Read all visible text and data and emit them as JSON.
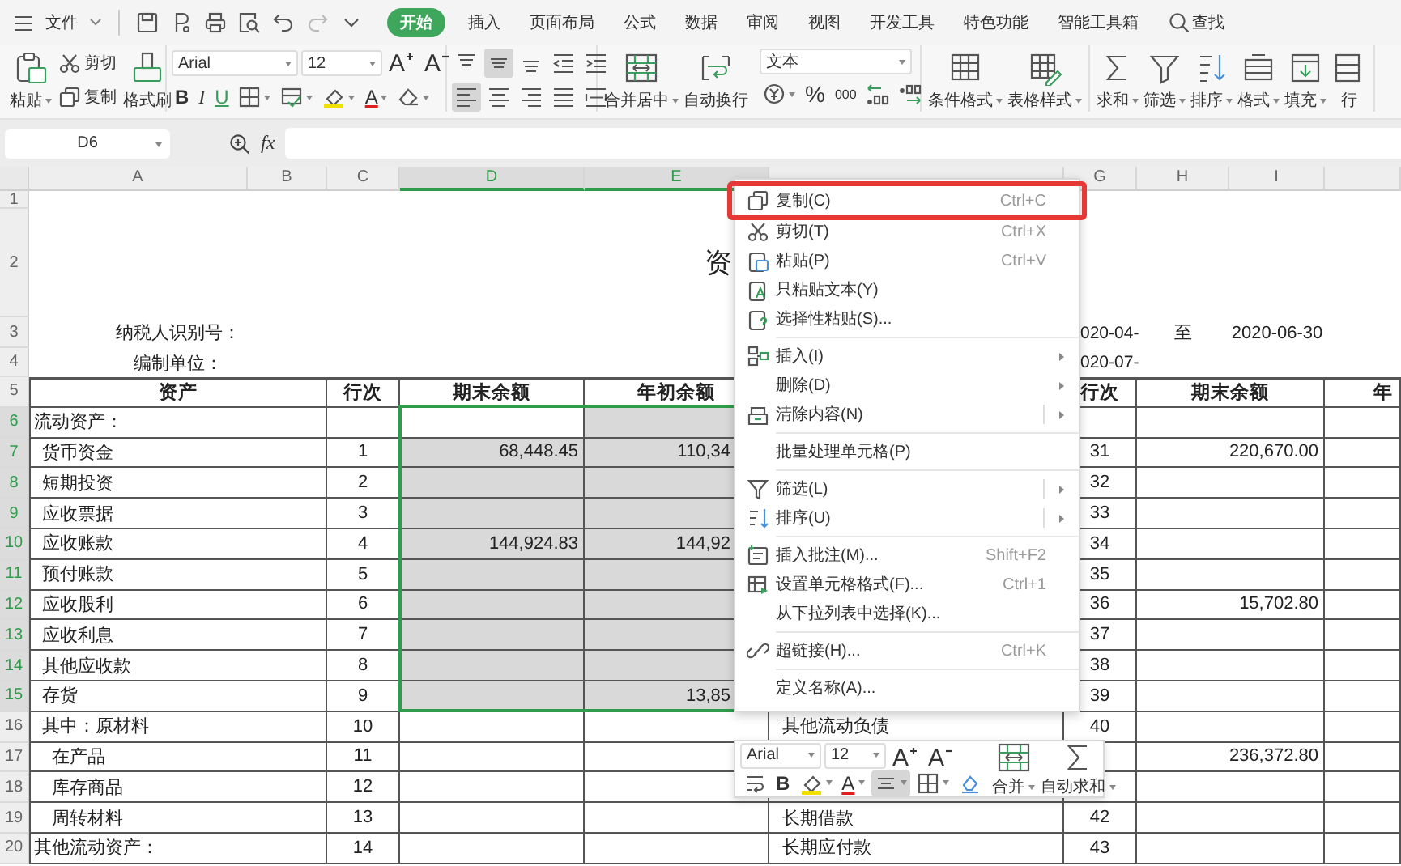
{
  "menu_bar": {
    "file_menu": "文件",
    "redo_disabled": true,
    "tabs": [
      {
        "label": "开始",
        "selected": true
      },
      {
        "label": "插入",
        "selected": false
      },
      {
        "label": "页面布局",
        "selected": false
      },
      {
        "label": "公式",
        "selected": false
      },
      {
        "label": "数据",
        "selected": false
      },
      {
        "label": "审阅",
        "selected": false
      },
      {
        "label": "视图",
        "selected": false
      },
      {
        "label": "开发工具",
        "selected": false
      },
      {
        "label": "特色功能",
        "selected": false
      },
      {
        "label": "智能工具箱",
        "selected": false
      }
    ],
    "search": "查找"
  },
  "ribbon": {
    "paste": "粘贴",
    "cut": "剪切",
    "copy": "复制",
    "format_painter": "格式刷",
    "font": "Arial",
    "font_size": "12",
    "grow_font": "A",
    "shrink_font": "A",
    "bold": "B",
    "italic": "I",
    "underline": "U",
    "font_color": "A",
    "vertical_align": [
      {
        "selected": false
      },
      {
        "selected": true
      },
      {
        "selected": false
      }
    ],
    "horizontal_align": [
      {
        "selected": true
      },
      {
        "selected": false
      },
      {
        "selected": false
      },
      {
        "selected": false
      },
      {
        "selected": false
      }
    ],
    "merge": "合并居中",
    "wrap": "自动换行",
    "number_format": "文本",
    "percent": "%",
    "thousands": "000",
    "tools": [
      {
        "label": "条件格式",
        "dropdown": true
      },
      {
        "label": "表格样式",
        "dropdown": true
      },
      {
        "label": "求和",
        "dropdown": true
      },
      {
        "label": "筛选",
        "dropdown": true
      },
      {
        "label": "排序",
        "dropdown": true
      },
      {
        "label": "格式",
        "dropdown": true
      },
      {
        "label": "填充",
        "dropdown": true
      },
      {
        "label": "行",
        "dropdown": false
      }
    ]
  },
  "formula_bar": {
    "name_box": "D6",
    "fx_label": "fx"
  },
  "sheet": {
    "columns": [
      {
        "label": "A",
        "selected": false
      },
      {
        "label": "B",
        "selected": false
      },
      {
        "label": "C",
        "selected": false
      },
      {
        "label": "D",
        "selected": true
      },
      {
        "label": "E",
        "selected": true
      },
      {
        "selected": false
      },
      {
        "label": "G",
        "selected": false
      },
      {
        "label": "H",
        "selected": false
      },
      {
        "label": "I",
        "selected": false
      }
    ],
    "rows": [
      {
        "header": "1",
        "kind": "blank",
        "selected": false,
        "active_cell": false
      },
      {
        "header": "2",
        "kind": "title",
        "selected": false,
        "active_cell": false,
        "cells": {
          "E": "资"
        }
      },
      {
        "header": "3",
        "kind": "info",
        "selected": false,
        "active_cell": false,
        "cells": {
          "A": "纳税人识别号：",
          "G": "020-04-",
          "H": "至",
          "I": "2020-06-30"
        }
      },
      {
        "header": "4",
        "kind": "info",
        "selected": false,
        "active_cell": false,
        "cells": {
          "A": "编制单位：",
          "G": "020-07-"
        }
      },
      {
        "header": "5",
        "kind": "head",
        "selected": false,
        "active_cell": false,
        "cells": {
          "A": "资产",
          "C": "行次",
          "D": "期末余额",
          "E": "年初余额",
          "G": "行次",
          "H": "期末余额",
          "J": "年"
        }
      },
      {
        "header": "6",
        "kind": "section",
        "selected": true,
        "active_cell": true,
        "cells": {
          "A": "流动资产："
        }
      },
      {
        "header": "7",
        "kind": "item",
        "selected": true,
        "active_cell": false,
        "cells": {
          "A": "货币资金",
          "C": "1",
          "D": "68,448.45",
          "E": "110,34",
          "G": "31",
          "H": "220,670.00"
        }
      },
      {
        "header": "8",
        "kind": "item",
        "selected": true,
        "active_cell": false,
        "cells": {
          "A": "短期投资",
          "C": "2",
          "G": "32"
        }
      },
      {
        "header": "9",
        "kind": "item",
        "selected": true,
        "active_cell": false,
        "cells": {
          "A": "应收票据",
          "C": "3",
          "G": "33"
        }
      },
      {
        "header": "10",
        "kind": "item",
        "selected": true,
        "active_cell": false,
        "cells": {
          "A": "应收账款",
          "C": "4",
          "D": "144,924.83",
          "E": "144,92",
          "G": "34"
        }
      },
      {
        "header": "11",
        "kind": "item",
        "selected": true,
        "active_cell": false,
        "cells": {
          "A": "预付账款",
          "C": "5",
          "G": "35"
        }
      },
      {
        "header": "12",
        "kind": "item",
        "selected": true,
        "active_cell": false,
        "cells": {
          "A": "应收股利",
          "C": "6",
          "G": "36",
          "H": "15,702.80"
        }
      },
      {
        "header": "13",
        "kind": "item",
        "selected": true,
        "active_cell": false,
        "cells": {
          "A": "应收利息",
          "C": "7",
          "G": "37"
        }
      },
      {
        "header": "14",
        "kind": "item",
        "selected": true,
        "active_cell": false,
        "cells": {
          "A": "其他应收款",
          "C": "8",
          "G": "38"
        }
      },
      {
        "header": "15",
        "kind": "item",
        "selected": true,
        "active_cell": false,
        "cells": {
          "A": "存货",
          "C": "9",
          "E": "13,85",
          "G": "39"
        }
      },
      {
        "header": "16",
        "kind": "item",
        "selected": false,
        "active_cell": false,
        "cells": {
          "A": "其中：原材料",
          "C": "10",
          "F": "其他流动负债",
          "G": "40"
        }
      },
      {
        "header": "17",
        "kind": "subitem",
        "selected": false,
        "active_cell": false,
        "cells": {
          "A": "在产品",
          "C": "11",
          "H": "236,372.80"
        }
      },
      {
        "header": "18",
        "kind": "subitem",
        "selected": false,
        "active_cell": false,
        "cells": {
          "A": "库存商品",
          "C": "12"
        }
      },
      {
        "header": "19",
        "kind": "subitem",
        "selected": false,
        "active_cell": false,
        "cells": {
          "A": "周转材料",
          "C": "13",
          "F": "长期借款",
          "G": "42"
        }
      },
      {
        "header": "20",
        "kind": "section",
        "selected": false,
        "active_cell": false,
        "cells": {
          "A": "其他流动资产：",
          "C": "14",
          "F": "长期应付款",
          "G": "43"
        }
      }
    ]
  },
  "context_menu": {
    "items": [
      {
        "kind": "command",
        "label": "复制(C)",
        "shortcut": "Ctrl+C",
        "highlighted": true
      },
      {
        "kind": "command",
        "label": "剪切(T)",
        "shortcut": "Ctrl+X",
        "highlighted": false
      },
      {
        "kind": "command",
        "label": "粘贴(P)",
        "shortcut": "Ctrl+V",
        "highlighted": false
      },
      {
        "kind": "command",
        "label": "只粘贴文本(Y)",
        "highlighted": false
      },
      {
        "kind": "command",
        "label": "选择性粘贴(S)...",
        "highlighted": false
      },
      {
        "kind": "separator"
      },
      {
        "kind": "command",
        "label": "插入(I)",
        "submenu": true,
        "highlighted": false
      },
      {
        "kind": "command",
        "label": "删除(D)",
        "submenu": true,
        "highlighted": false
      },
      {
        "kind": "command",
        "label": "清除内容(N)",
        "submenu": true,
        "split": true,
        "highlighted": false
      },
      {
        "kind": "separator"
      },
      {
        "kind": "command",
        "label": "批量处理单元格(P)",
        "highlighted": false
      },
      {
        "kind": "separator"
      },
      {
        "kind": "command",
        "label": "筛选(L)",
        "submenu": true,
        "split": true,
        "highlighted": false
      },
      {
        "kind": "command",
        "label": "排序(U)",
        "submenu": true,
        "split": true,
        "highlighted": false
      },
      {
        "kind": "separator"
      },
      {
        "kind": "command",
        "label": "插入批注(M)...",
        "shortcut": "Shift+F2",
        "highlighted": false
      },
      {
        "kind": "command",
        "label": "设置单元格格式(F)...",
        "shortcut": "Ctrl+1",
        "highlighted": false
      },
      {
        "kind": "command",
        "label": "从下拉列表中选择(K)...",
        "highlighted": false
      },
      {
        "kind": "separator"
      },
      {
        "kind": "command",
        "label": "超链接(H)...",
        "shortcut": "Ctrl+K",
        "highlighted": false
      },
      {
        "kind": "separator"
      },
      {
        "kind": "command",
        "label": "定义名称(A)...",
        "highlighted": false
      }
    ]
  },
  "mini_toolbar": {
    "font": "Arial",
    "size": "12",
    "grow_font": "A",
    "shrink_font": "A",
    "bold": "B",
    "font_color": "A",
    "align_selected": true,
    "merge": "合并",
    "autosum": "自动求和"
  }
}
